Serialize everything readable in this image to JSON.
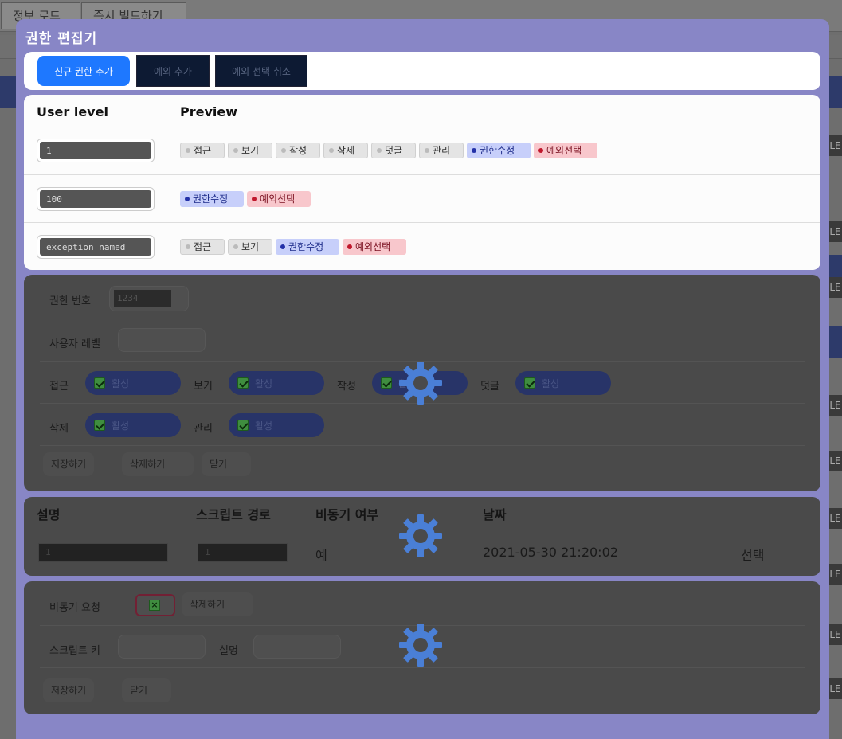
{
  "background": {
    "tabs": [
      "정보 로드",
      "즉시 빌드하기"
    ],
    "side_label": "LE"
  },
  "modal": {
    "title": "권한 편집기",
    "toolbar": {
      "add_label": "신규 권한 추가",
      "exception_add_label": "예외 추가",
      "exception_cancel_label": "예외 선택 취소"
    },
    "levels": {
      "headers": {
        "level": "User level",
        "preview": "Preview"
      },
      "rows": [
        {
          "value": "1",
          "chips": [
            {
              "text": "접근",
              "kind": "gray"
            },
            {
              "text": "보기",
              "kind": "gray"
            },
            {
              "text": "작성",
              "kind": "gray"
            },
            {
              "text": "삭제",
              "kind": "gray"
            },
            {
              "text": "덧글",
              "kind": "gray"
            },
            {
              "text": "관리",
              "kind": "gray"
            },
            {
              "text": "권한수정",
              "kind": "blue"
            },
            {
              "text": "예외선택",
              "kind": "red"
            }
          ]
        },
        {
          "value": "100",
          "chips": [
            {
              "text": "권한수정",
              "kind": "blue"
            },
            {
              "text": "예외선택",
              "kind": "red"
            }
          ]
        },
        {
          "value": "exception_named",
          "chips": [
            {
              "text": "접근",
              "kind": "gray"
            },
            {
              "text": "보기",
              "kind": "gray"
            },
            {
              "text": "권한수정",
              "kind": "blue"
            },
            {
              "text": "예외선택",
              "kind": "red"
            }
          ]
        }
      ]
    },
    "editor": {
      "perm_no_label": "권한 번호",
      "perm_no_value": "1234",
      "user_level_label": "사용자 레벨",
      "user_level_value": "",
      "access_label": "접근",
      "view_label": "보기",
      "write_label": "작성",
      "comment_label": "덧글",
      "delete_label": "삭제",
      "manage_label": "관리",
      "active_label": "활성",
      "save_label": "저장하기",
      "remove_label": "삭제하기",
      "close_label": "닫기"
    },
    "script_table": {
      "headers": {
        "desc": "설명",
        "path": "스크립트 경로",
        "async": "비동기 여부",
        "date": "날짜"
      },
      "row": {
        "desc": "1",
        "path": "1",
        "async": "예",
        "date": "2021-05-30 21:20:02",
        "action": "선택"
      }
    },
    "async_form": {
      "async_label": "비동기 요청",
      "remove_label": "삭제하기",
      "script_key_label": "스크립트 키",
      "desc_label": "설명",
      "save_label": "저장하기",
      "close_label": "닫기"
    }
  },
  "colors": {
    "modal_bg": "#8886c6",
    "primary": "#1e78ff",
    "chip_blue": "#c7cffa",
    "chip_red": "#f8c7cc",
    "spinner": "#4a7fd6"
  }
}
